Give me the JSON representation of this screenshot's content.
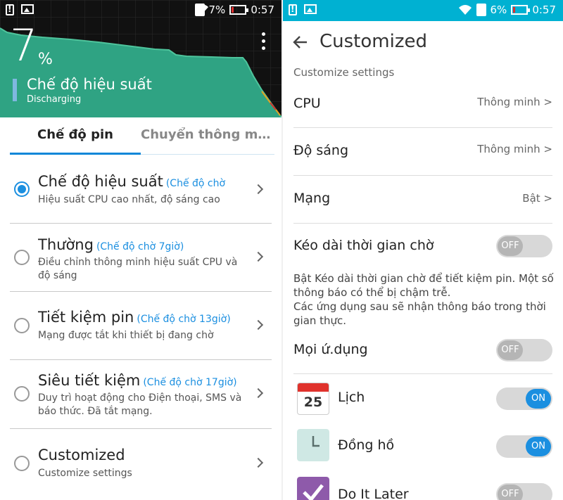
{
  "status": {
    "left_battery": "7%",
    "left_time": "0:57",
    "right_battery": "6%",
    "right_time": "0:57"
  },
  "battery": {
    "percent": "7",
    "percent_sign": "%",
    "mode_name": "Chế độ hiệu suất",
    "state": "Discharging"
  },
  "tabs": [
    {
      "label": "Chế độ pin",
      "active": true
    },
    {
      "label": "Chuyển thông minh",
      "active": false
    }
  ],
  "modes": [
    {
      "title": "Chế độ hiệu suất",
      "standby": "(Chế độ chờ",
      "desc": "Hiệu suất CPU cao nhất, độ sáng cao",
      "selected": true
    },
    {
      "title": "Thường",
      "standby": "(Chế độ chờ 7giờ)",
      "desc": "Điều chỉnh thông minh hiệu suất CPU và độ sáng",
      "selected": false
    },
    {
      "title": "Tiết kiệm pin",
      "standby": "(Chế độ chờ 13giờ)",
      "desc": "Mạng được tắt khi thiết bị đang chờ",
      "selected": false
    },
    {
      "title": "Siêu tiết kiệm",
      "standby": "(Chế độ chờ 17giờ)",
      "desc": "Duy trì hoạt động cho Điện thoại, SMS và báo thức. Đã tắt mạng.",
      "selected": false
    },
    {
      "title": "Customized",
      "standby": "",
      "desc": "Customize settings",
      "selected": false
    }
  ],
  "custom": {
    "title": "Customized",
    "subtitle": "Customize settings",
    "rows": [
      {
        "label": "CPU",
        "value": "Thông minh >"
      },
      {
        "label": "Độ sáng",
        "value": "Thông minh >"
      },
      {
        "label": "Mạng",
        "value": "Bật >"
      }
    ],
    "standby_label": "Kéo dài thời gian chờ",
    "standby_toggle": "OFF",
    "note": "Bật Kéo dài thời gian chờ để tiết kiệm pin. Một số thông báo có thể bị chậm trễ.\nCác ứng dụng sau sẽ nhận thông báo trong thời gian thực.",
    "all_apps_label": "Mọi ứ.dụng",
    "all_apps_toggle": "OFF",
    "apps": [
      {
        "name": "Lịch",
        "icon": "calendar-icon",
        "icon_text": "25",
        "toggle": "ON"
      },
      {
        "name": "Đồng hồ",
        "icon": "clock-icon",
        "toggle": "ON"
      },
      {
        "name": "Do It Later",
        "icon": "check-icon",
        "toggle": "OFF"
      }
    ]
  },
  "colors": {
    "accent": "#1b8fe0",
    "status_right": "#00b1d2",
    "graph_fill": "#2fa383"
  }
}
